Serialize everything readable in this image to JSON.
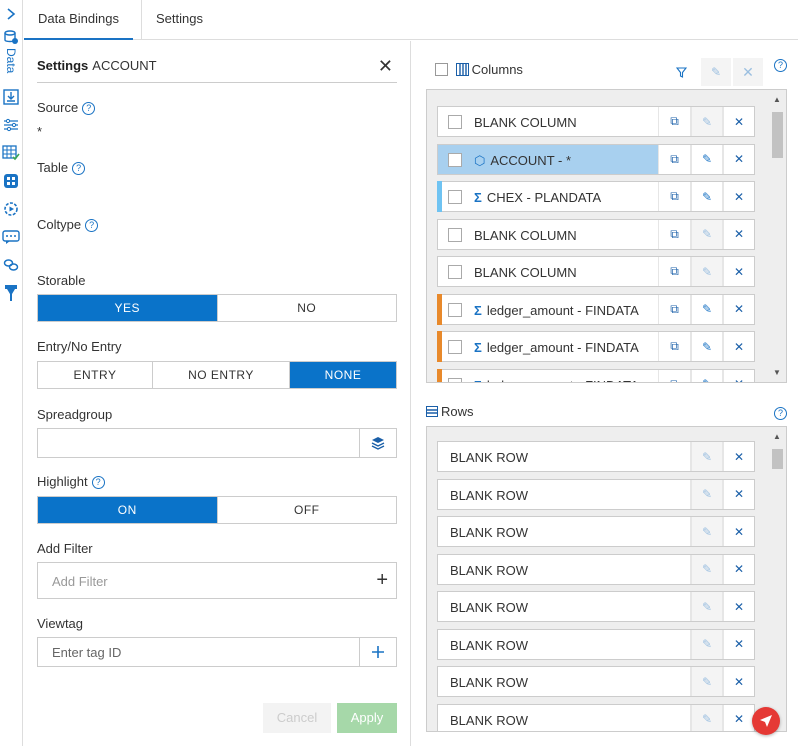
{
  "rail": {
    "label": "Data"
  },
  "tabs": [
    {
      "label": "Data Bindings",
      "active": true
    },
    {
      "label": "Settings",
      "active": false
    }
  ],
  "settings": {
    "title": "Settings",
    "subtitle": "ACCOUNT",
    "source": {
      "label": "Source",
      "value": "*"
    },
    "table": {
      "label": "Table"
    },
    "coltype": {
      "label": "Coltype"
    },
    "storable": {
      "label": "Storable",
      "options": [
        "YES",
        "NO"
      ],
      "selected": "YES"
    },
    "entry": {
      "label": "Entry/No Entry",
      "options": [
        "ENTRY",
        "NO ENTRY",
        "NONE"
      ],
      "selected": "NONE"
    },
    "spreadgroup": {
      "label": "Spreadgroup",
      "value": ""
    },
    "highlight": {
      "label": "Highlight",
      "options": [
        "ON",
        "OFF"
      ],
      "selected": "ON"
    },
    "add_filter": {
      "label": "Add Filter",
      "placeholder": "Add Filter"
    },
    "viewtag": {
      "label": "Viewtag",
      "placeholder": "Enter tag ID"
    },
    "cancel_label": "Cancel",
    "apply_label": "Apply"
  },
  "columns": {
    "title": "Columns",
    "items": [
      {
        "label": "BLANK COLUMN",
        "icon": "",
        "bar": "",
        "selected": false,
        "edit_enabled": false
      },
      {
        "label": "ACCOUNT - *",
        "icon": "cube-icon",
        "bar": "",
        "selected": true,
        "edit_enabled": true
      },
      {
        "label": "CHEX - PLANDATA",
        "icon": "sigma-icon",
        "bar": "#6fc3f2",
        "selected": false,
        "edit_enabled": true
      },
      {
        "label": "BLANK COLUMN",
        "icon": "",
        "bar": "",
        "selected": false,
        "edit_enabled": false
      },
      {
        "label": "BLANK COLUMN",
        "icon": "",
        "bar": "",
        "selected": false,
        "edit_enabled": false
      },
      {
        "label": "ledger_amount - FINDATA",
        "icon": "sigma-icon",
        "bar": "#e8892b",
        "selected": false,
        "edit_enabled": true
      },
      {
        "label": "ledger_amount - FINDATA",
        "icon": "sigma-icon",
        "bar": "#e8892b",
        "selected": false,
        "edit_enabled": true
      },
      {
        "label": "ledger_amount - FINDATA",
        "icon": "sigma-icon",
        "bar": "#e8892b",
        "selected": false,
        "edit_enabled": true
      }
    ]
  },
  "rows": {
    "title": "Rows",
    "items": [
      {
        "label": "BLANK ROW"
      },
      {
        "label": "BLANK ROW"
      },
      {
        "label": "BLANK ROW"
      },
      {
        "label": "BLANK ROW"
      },
      {
        "label": "BLANK ROW"
      },
      {
        "label": "BLANK ROW"
      },
      {
        "label": "BLANK ROW"
      },
      {
        "label": "BLANK ROW"
      }
    ]
  },
  "colors": {
    "primary": "#0a73c9",
    "apply": "#a6d8a9",
    "selected_row": "#a8d0ef",
    "orange_bar": "#e8892b",
    "blue_bar": "#6fc3f2"
  }
}
